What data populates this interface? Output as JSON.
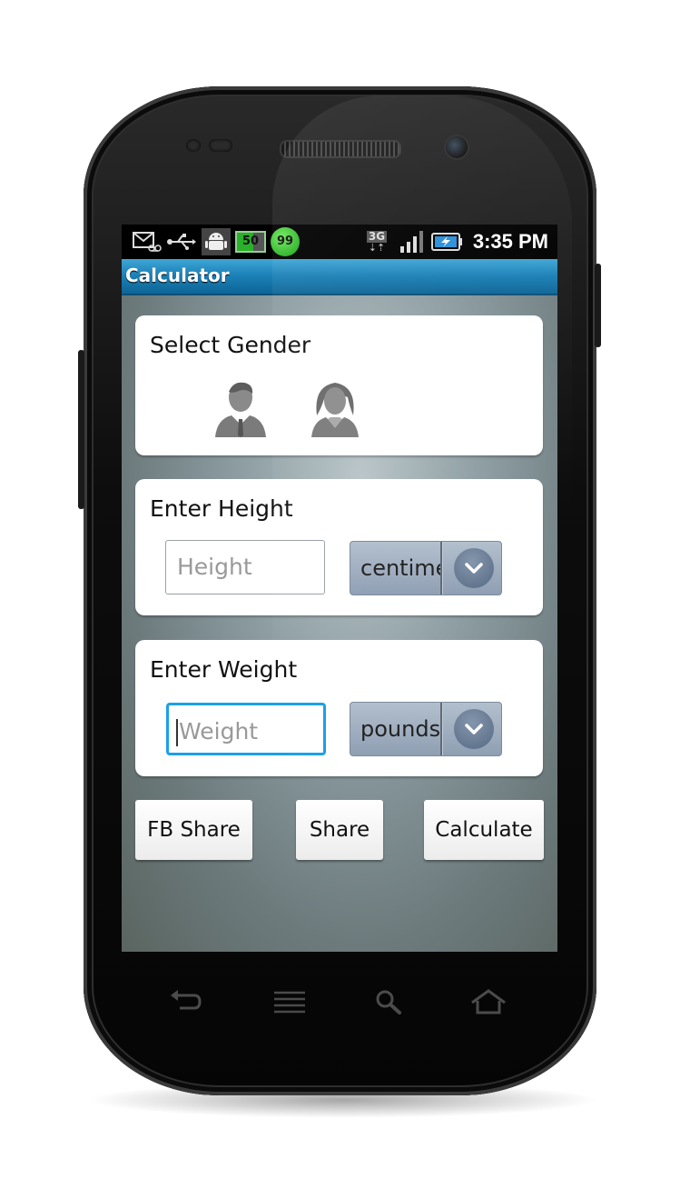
{
  "status_bar": {
    "icons": [
      "mail-voicemail-icon",
      "usb-icon",
      "android-debug-icon",
      "battery-widget-icon",
      "percent-circle-icon",
      "3g-icon",
      "signal-icon",
      "battery-charging-icon"
    ],
    "widget_value_1": "50",
    "widget_value_2": "99",
    "network_label": "3G",
    "time": "3:35 PM"
  },
  "app": {
    "title": "Calculator",
    "accent_color": "#1a7fb5"
  },
  "gender": {
    "title": "Select Gender",
    "options": [
      "male-icon",
      "female-icon"
    ]
  },
  "height": {
    "title": "Enter Height",
    "placeholder": "Height",
    "unit_selected": "centimeters"
  },
  "weight": {
    "title": "Enter Weight",
    "placeholder": "Weight",
    "unit_selected": "pounds"
  },
  "actions": {
    "fb_share": "FB Share",
    "share": "Share",
    "calculate": "Calculate"
  },
  "nav_keys": [
    "back-icon",
    "menu-icon",
    "search-icon",
    "home-icon"
  ]
}
